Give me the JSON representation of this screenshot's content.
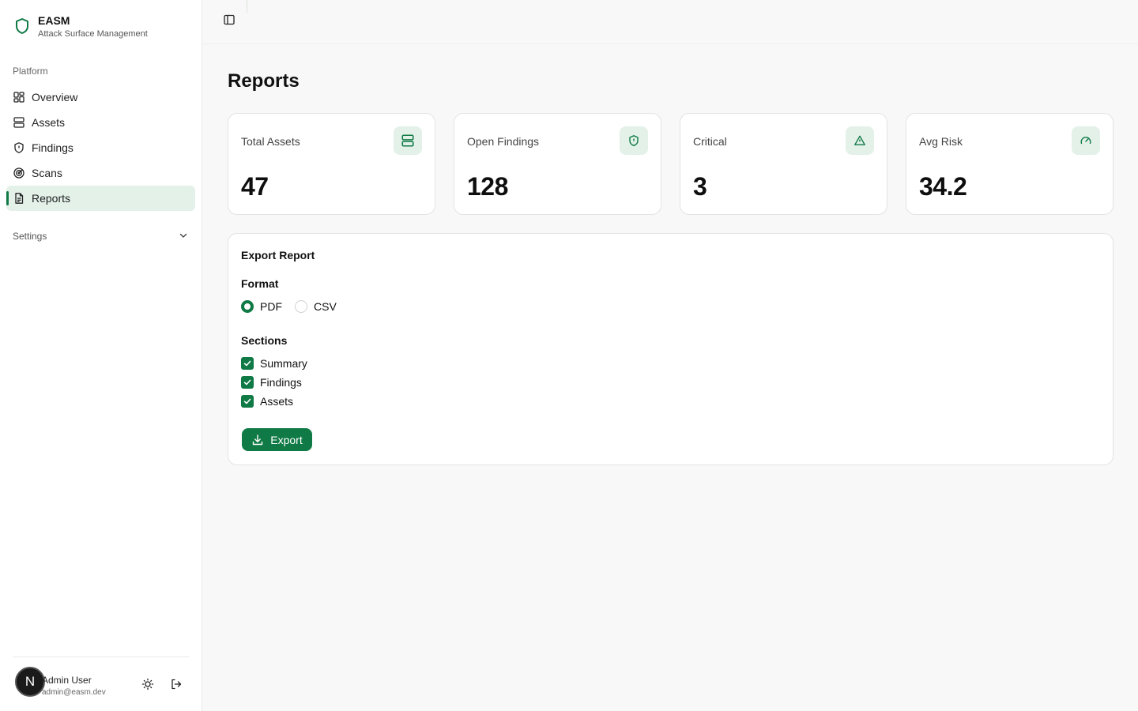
{
  "app": {
    "name": "EASM",
    "subtitle": "Attack Surface Management"
  },
  "sidebar": {
    "group_label": "Platform",
    "items": [
      {
        "label": "Overview",
        "icon": "grid-icon"
      },
      {
        "label": "Assets",
        "icon": "server-icon"
      },
      {
        "label": "Findings",
        "icon": "shield-alert-icon"
      },
      {
        "label": "Scans",
        "icon": "radar-icon"
      },
      {
        "label": "Reports",
        "icon": "file-text-icon",
        "active": true
      }
    ],
    "settings_label": "Settings"
  },
  "user": {
    "initial": "N",
    "name": "Admin User",
    "email": "admin@easm.dev"
  },
  "page": {
    "title": "Reports"
  },
  "stats": [
    {
      "label": "Total Assets",
      "value": "47",
      "icon": "server-icon"
    },
    {
      "label": "Open Findings",
      "value": "128",
      "icon": "shield-alert-icon"
    },
    {
      "label": "Critical",
      "value": "3",
      "icon": "warning-triangle-icon"
    },
    {
      "label": "Avg Risk",
      "value": "34.2",
      "icon": "gauge-icon"
    }
  ],
  "export": {
    "title": "Export Report",
    "format_label": "Format",
    "formats": [
      {
        "label": "PDF",
        "selected": true
      },
      {
        "label": "CSV",
        "selected": false
      }
    ],
    "sections_label": "Sections",
    "sections": [
      {
        "label": "Summary",
        "checked": true
      },
      {
        "label": "Findings",
        "checked": true
      },
      {
        "label": "Assets",
        "checked": true
      }
    ],
    "button_label": "Export"
  },
  "colors": {
    "accent": "#0f7a45",
    "accent_light": "#e3f1e9"
  }
}
